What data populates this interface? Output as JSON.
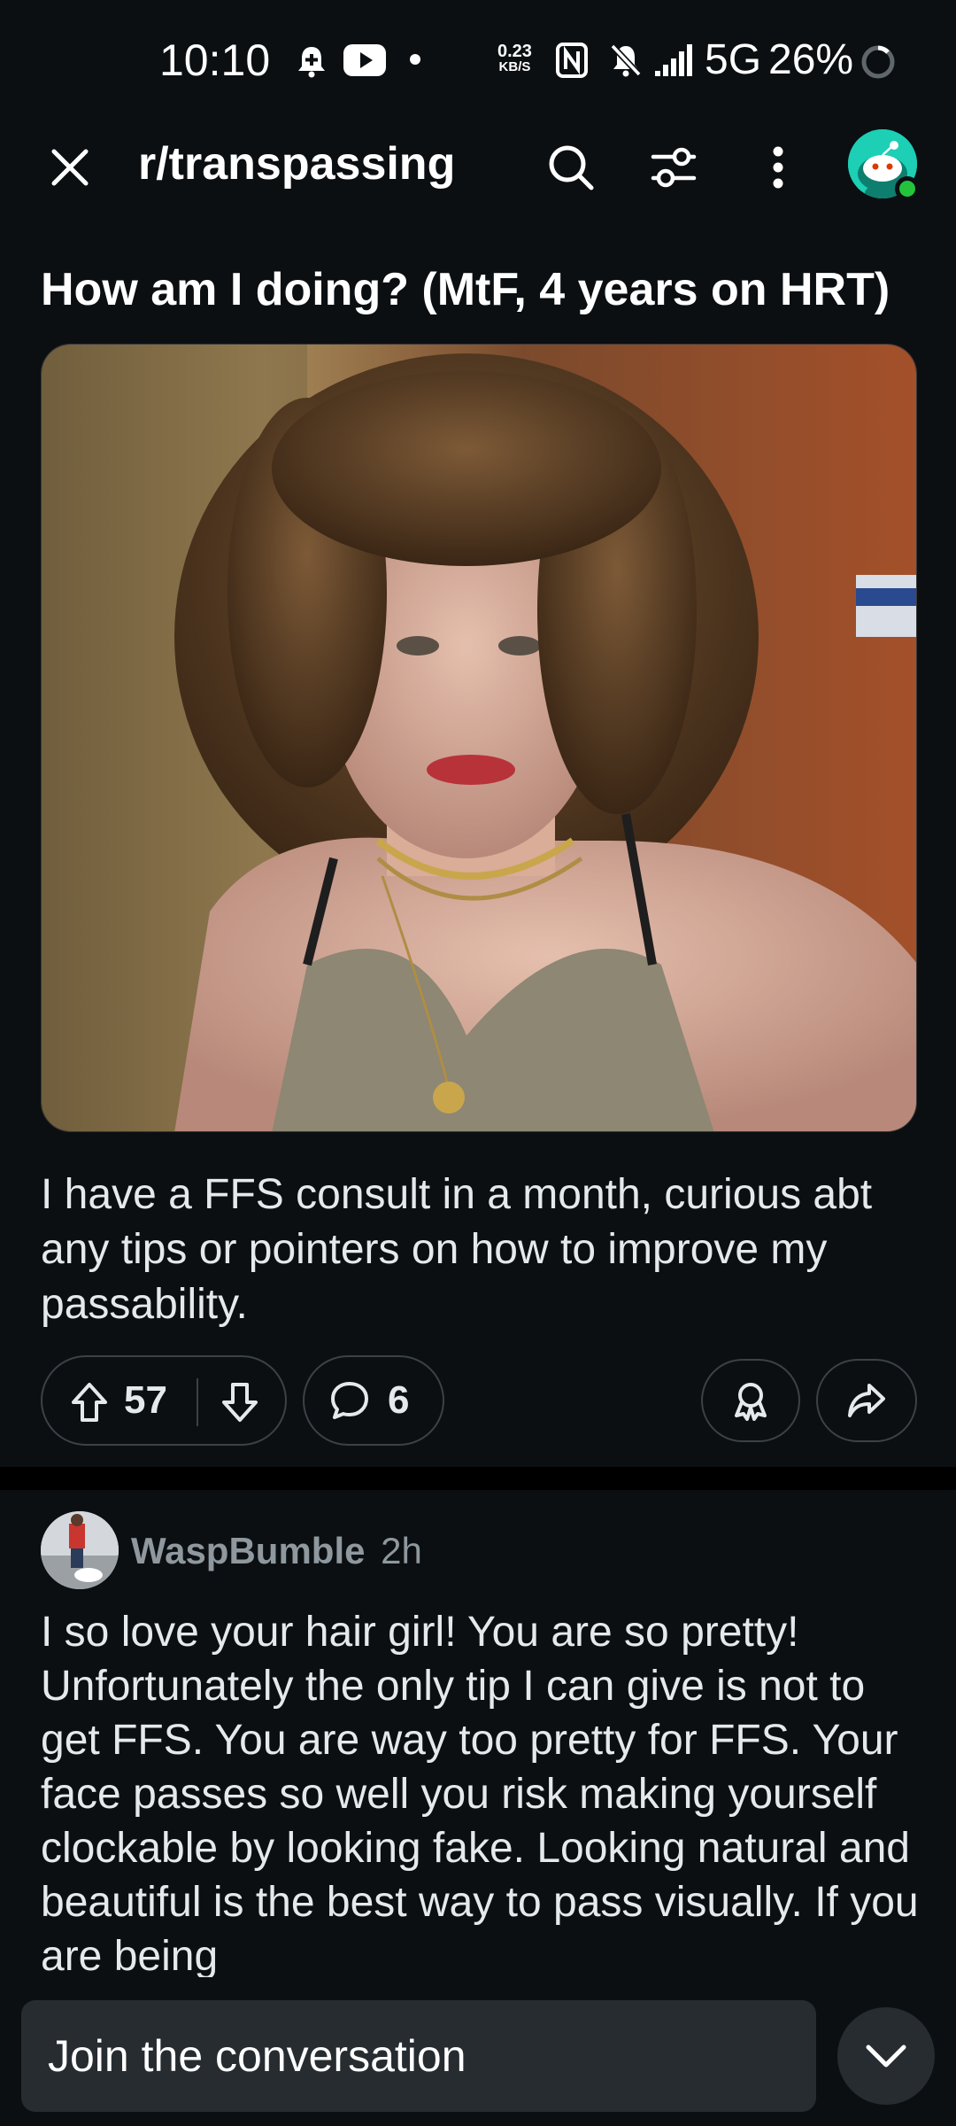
{
  "status_bar": {
    "time": "10:10",
    "speed_value": "0.23",
    "speed_unit": "KB/S",
    "network": "5G",
    "battery": "26%"
  },
  "top_bar": {
    "subreddit": "r/transpassing",
    "icons": [
      "close-icon",
      "search-icon",
      "filter-icon",
      "more-icon",
      "avatar"
    ]
  },
  "post": {
    "title": "How am I doing? (MtF, 4 years on HRT)",
    "body": "I have a FFS consult in a month, curious abt any tips or pointers on how to improve my passability.",
    "upvotes": "57",
    "comments": "6"
  },
  "comment": {
    "author": "WaspBumble",
    "time": "2h",
    "body": "I so love your hair girl! You are so pretty! Unfortunately the only tip I can give is not to get FFS. You are way too pretty for FFS. Your face passes so well you risk making yourself clockable by looking fake. Looking natural and beautiful is the best way to pass visually. If you are being"
  },
  "bottom_bar": {
    "input_placeholder": "Join the conversation"
  },
  "colors": {
    "background": "#0b0f12",
    "pill_border": "#3b4246",
    "avatar_teal": "#1ccfb5",
    "online_green": "#23c43c",
    "input_bg": "#262c30"
  }
}
